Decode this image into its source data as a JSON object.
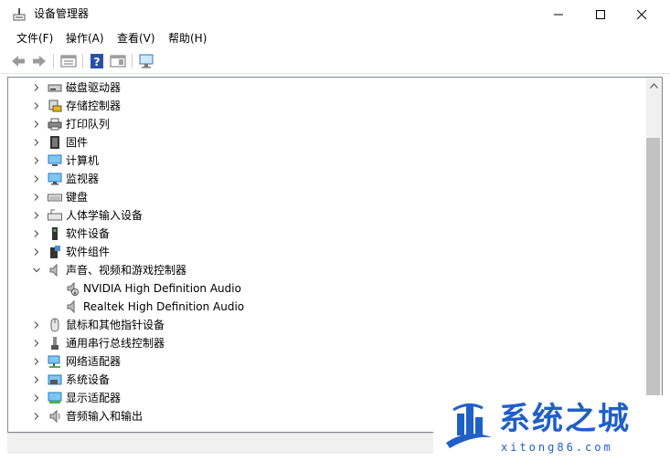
{
  "window": {
    "title": "设备管理器",
    "minimize_icon": "minimize-icon",
    "maximize_icon": "maximize-icon",
    "close_icon": "close-icon"
  },
  "menu": [
    "文件(F)",
    "操作(A)",
    "查看(V)",
    "帮助(H)"
  ],
  "toolbar": [
    "back-arrow-icon",
    "forward-arrow-icon",
    "properties-icon",
    "help-icon",
    "action-pane-icon",
    "scan-hardware-icon"
  ],
  "tree": [
    {
      "label": "磁盘驱动器",
      "icon": "disk-drive-icon",
      "expanded": false
    },
    {
      "label": "存储控制器",
      "icon": "storage-controller-icon",
      "expanded": false
    },
    {
      "label": "打印队列",
      "icon": "printer-icon",
      "expanded": false
    },
    {
      "label": "固件",
      "icon": "firmware-icon",
      "expanded": false
    },
    {
      "label": "计算机",
      "icon": "computer-icon",
      "expanded": false
    },
    {
      "label": "监视器",
      "icon": "monitor-icon",
      "expanded": false
    },
    {
      "label": "键盘",
      "icon": "keyboard-icon",
      "expanded": false
    },
    {
      "label": "人体学输入设备",
      "icon": "hid-icon",
      "expanded": false
    },
    {
      "label": "软件设备",
      "icon": "software-device-icon",
      "expanded": false
    },
    {
      "label": "软件组件",
      "icon": "software-component-icon",
      "expanded": false
    },
    {
      "label": "声音、视频和游戏控制器",
      "icon": "speaker-icon",
      "expanded": true,
      "children": [
        {
          "label": "NVIDIA High Definition Audio",
          "icon": "speaker-warning-icon"
        },
        {
          "label": "Realtek High Definition Audio",
          "icon": "speaker-icon"
        }
      ]
    },
    {
      "label": "鼠标和其他指针设备",
      "icon": "mouse-icon",
      "expanded": false
    },
    {
      "label": "通用串行总线控制器",
      "icon": "usb-icon",
      "expanded": false
    },
    {
      "label": "网络适配器",
      "icon": "network-adapter-icon",
      "expanded": false
    },
    {
      "label": "系统设备",
      "icon": "system-device-icon",
      "expanded": false
    },
    {
      "label": "显示适配器",
      "icon": "display-adapter-icon",
      "expanded": false
    },
    {
      "label": "音频输入和输出",
      "icon": "audio-io-icon",
      "expanded": false
    }
  ],
  "watermark": {
    "name": "系统之城",
    "url": "xitong86.com",
    "color": "#1f5fc8"
  }
}
